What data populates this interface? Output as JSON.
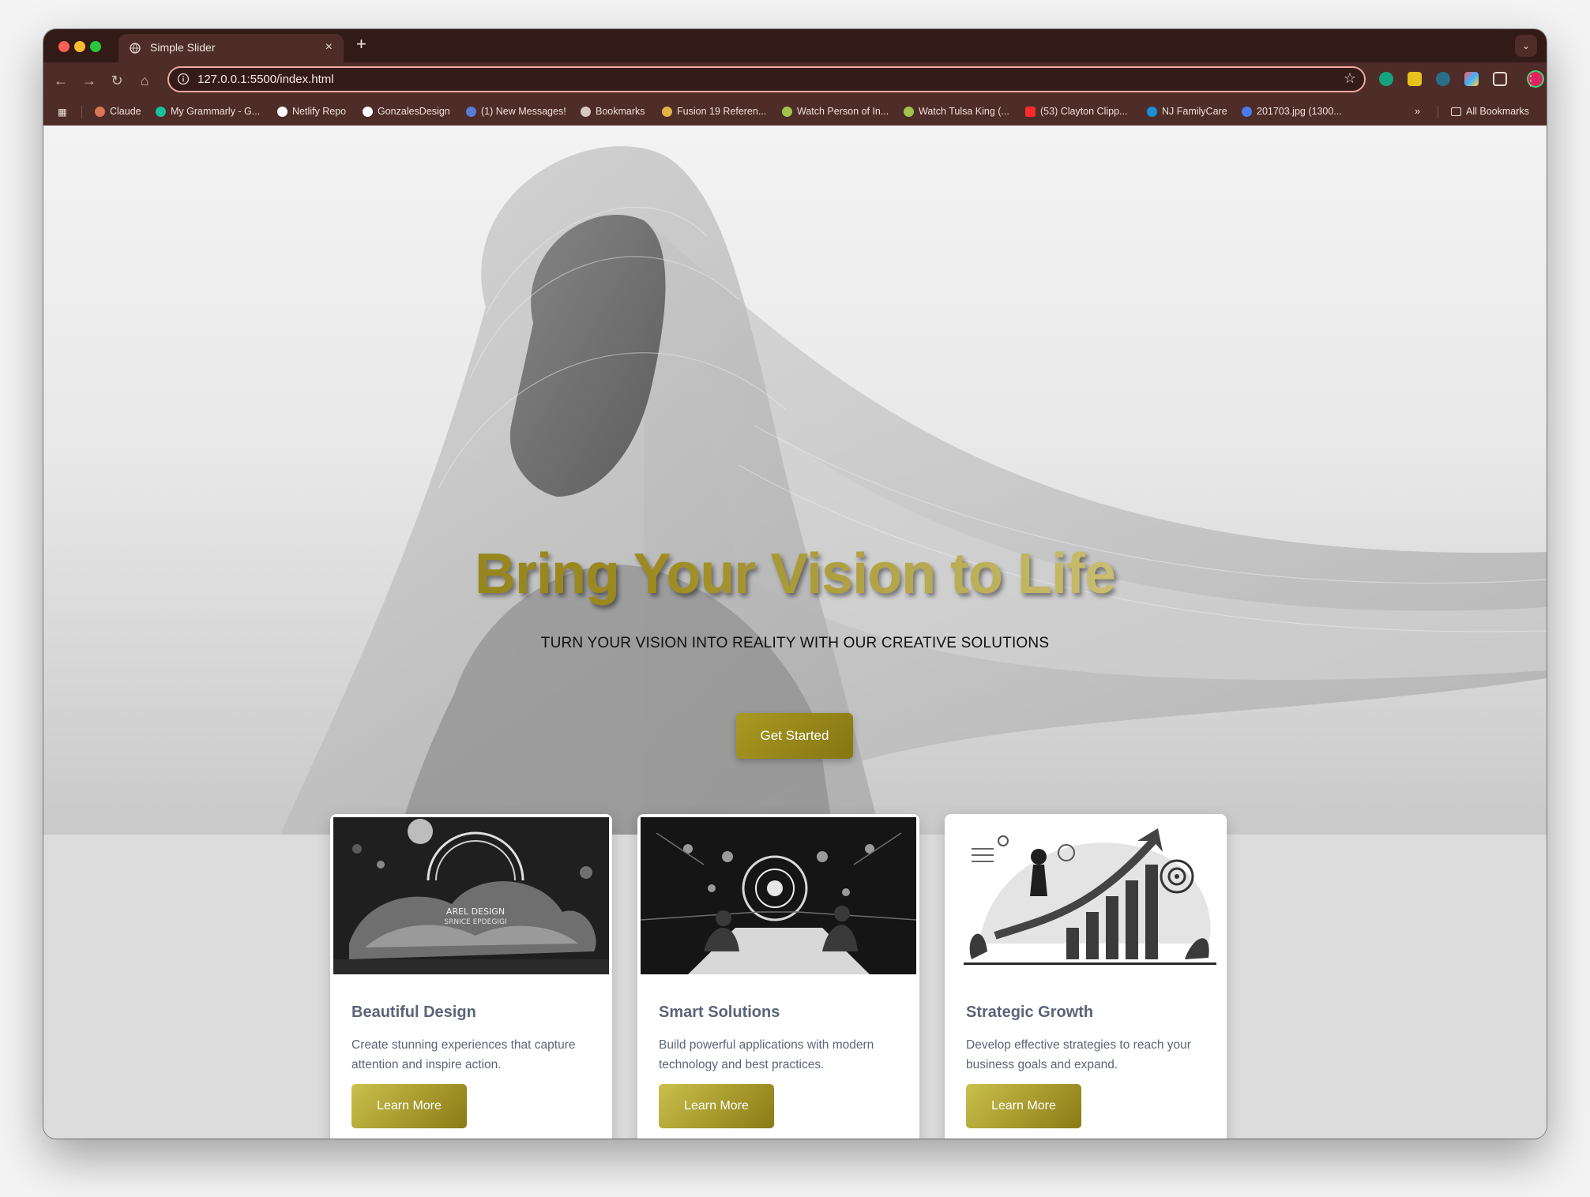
{
  "browser": {
    "tab_title": "Simple Slider",
    "tab_close": "×",
    "new_tab": "+",
    "tab_menu": "⌄",
    "url": "127.0.0.1:5500/index.html",
    "bookmarks": [
      {
        "label": "Claude",
        "color": "#d97757"
      },
      {
        "label": "My Grammarly - G...",
        "color": "#15c39a"
      },
      {
        "label": "Netlify Repo",
        "color": "#ffffff"
      },
      {
        "label": "GonzalesDesign",
        "color": "#ffffff"
      },
      {
        "label": "(1) New Messages!",
        "color": "#5a7bd6"
      },
      {
        "label": "Bookmarks",
        "color": "#d8c8c4"
      },
      {
        "label": "Fusion 19 Referen...",
        "color": "#e4b343"
      },
      {
        "label": "Watch Person of In...",
        "color": "#a3c34a"
      },
      {
        "label": "Watch Tulsa King (...",
        "color": "#a3c34a"
      },
      {
        "label": "(53) Clayton Clipp...",
        "color": "#ff2a2a"
      },
      {
        "label": "NJ FamilyCare",
        "color": "#1b8fd6"
      },
      {
        "label": "201703.jpg (1300...",
        "color": "#4a7cf0"
      }
    ],
    "bookmarks_overflow": "»",
    "all_bookmarks": "All Bookmarks"
  },
  "hero": {
    "title": "Bring Your Vision to Life",
    "subtitle": "TURN YOUR VISION INTO REALITY WITH OUR CREATIVE SOLUTIONS",
    "cta": "Get Started"
  },
  "cards": [
    {
      "title": "Beautiful Design",
      "description": "Create stunning experiences that capture attention and inspire action.",
      "button": "Learn More",
      "image_text": "AREL DESIGN\nSRNICE EPDEGIGI"
    },
    {
      "title": "Smart Solutions",
      "description": "Build powerful applications with modern technology and best practices.",
      "button": "Learn More"
    },
    {
      "title": "Strategic Growth",
      "description": "Develop effective strategies to reach your business goals and expand.",
      "button": "Learn More"
    }
  ],
  "colors": {
    "accent_gold": "#9c8a1e",
    "chrome_dark": "#321a17",
    "chrome": "#4e2c28"
  }
}
